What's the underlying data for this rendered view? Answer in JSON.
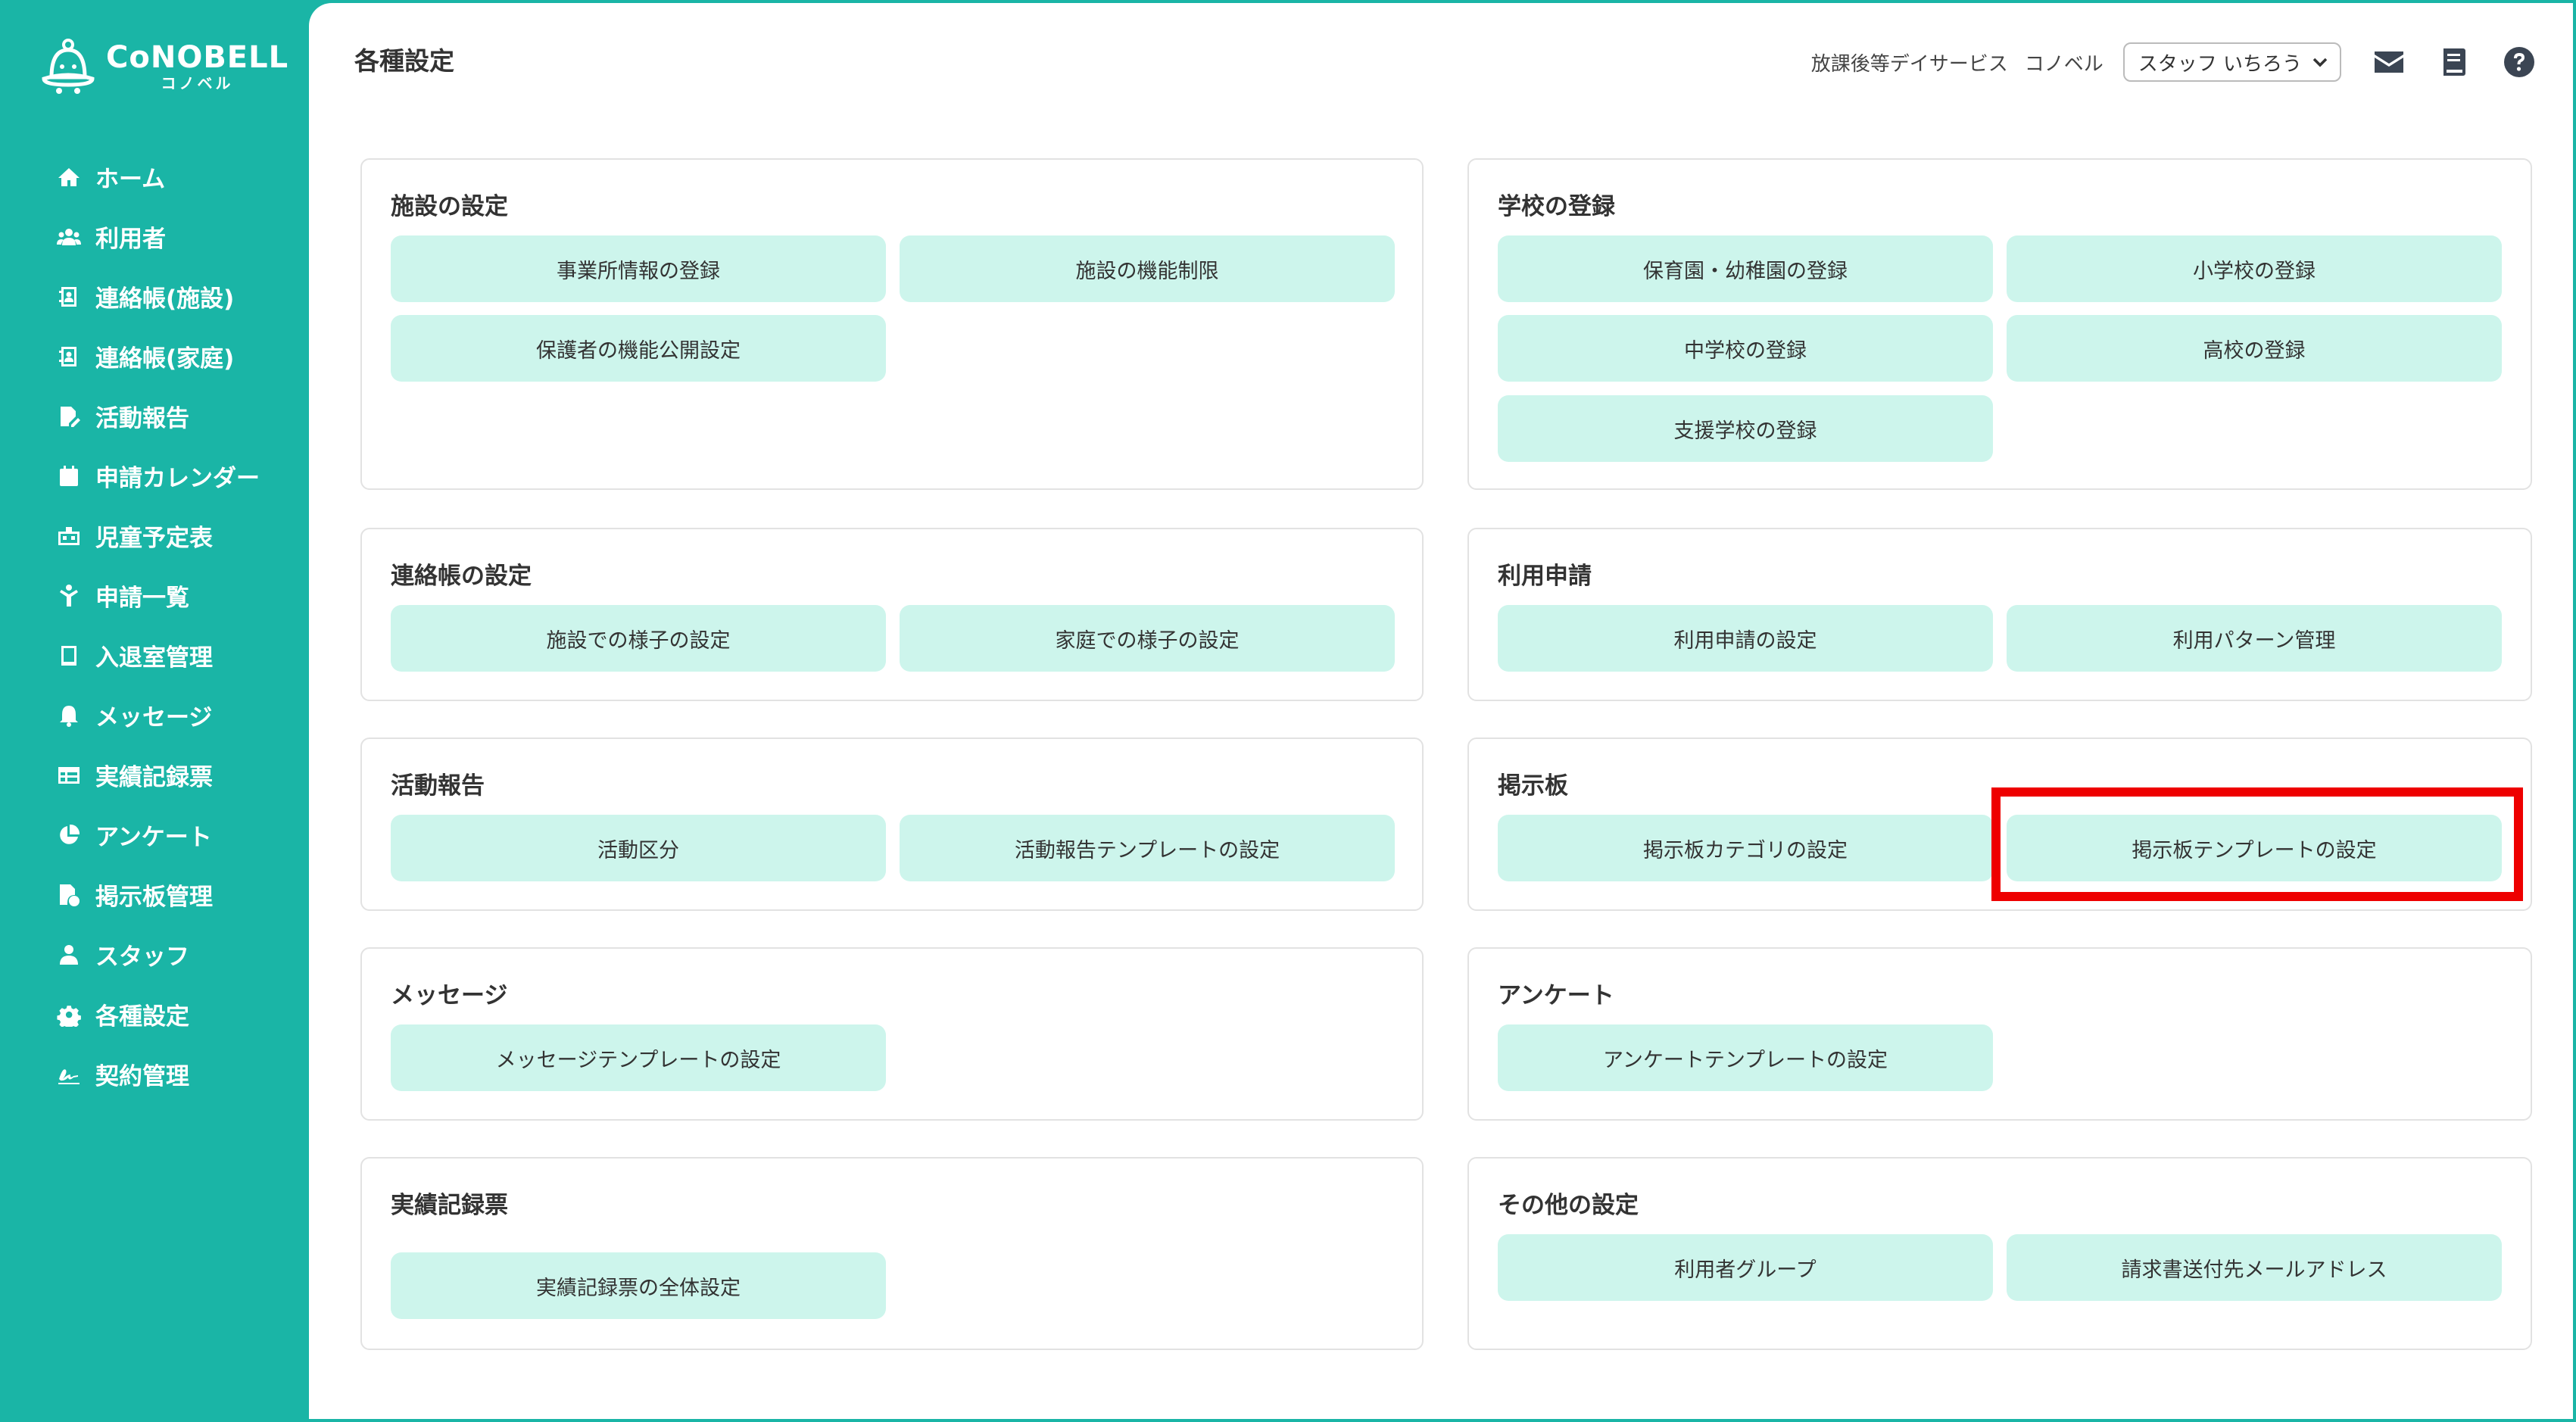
{
  "app": {
    "logo_title": "CoNOBELL",
    "logo_sub": "コノベル"
  },
  "sidebar": {
    "items": [
      {
        "label": "ホーム",
        "icon": "home-icon"
      },
      {
        "label": "利用者",
        "icon": "users-icon"
      },
      {
        "label": "連絡帳(施設)",
        "icon": "contact-book-icon"
      },
      {
        "label": "連絡帳(家庭)",
        "icon": "contact-book-icon"
      },
      {
        "label": "活動報告",
        "icon": "report-edit-icon"
      },
      {
        "label": "申請カレンダー",
        "icon": "calendar-icon"
      },
      {
        "label": "児童予定表",
        "icon": "schedule-icon"
      },
      {
        "label": "申請一覧",
        "icon": "person-icon"
      },
      {
        "label": "入退室管理",
        "icon": "tablet-icon"
      },
      {
        "label": "メッセージ",
        "icon": "bell-icon"
      },
      {
        "label": "実績記録票",
        "icon": "table-icon"
      },
      {
        "label": "アンケート",
        "icon": "pie-chart-icon"
      },
      {
        "label": "掲示板管理",
        "icon": "board-icon"
      },
      {
        "label": "スタッフ",
        "icon": "staff-icon"
      },
      {
        "label": "各種設定",
        "icon": "gear-icon"
      },
      {
        "label": "契約管理",
        "icon": "signature-icon"
      }
    ]
  },
  "header": {
    "title": "各種設定",
    "facility": "放課後等デイサービス",
    "company": "コノベル",
    "staff_selected": "スタッフ いちろう",
    "icons": [
      "mail-icon",
      "book-icon",
      "help-icon"
    ]
  },
  "cards": {
    "facility": {
      "title": "施設の設定",
      "buttons": [
        "事業所情報の登録",
        "施設の機能制限",
        "保護者の機能公開設定"
      ]
    },
    "school": {
      "title": "学校の登録",
      "buttons": [
        "保育園・幼稚園の登録",
        "小学校の登録",
        "中学校の登録",
        "高校の登録",
        "支援学校の登録"
      ]
    },
    "contact": {
      "title": "連絡帳の設定",
      "buttons": [
        "施設での様子の設定",
        "家庭での様子の設定"
      ]
    },
    "usage": {
      "title": "利用申請",
      "buttons": [
        "利用申請の設定",
        "利用パターン管理"
      ]
    },
    "activity": {
      "title": "活動報告",
      "buttons": [
        "活動区分",
        "活動報告テンプレートの設定"
      ]
    },
    "board": {
      "title": "掲示板",
      "buttons": [
        "掲示板カテゴリの設定",
        "掲示板テンプレートの設定"
      ]
    },
    "message": {
      "title": "メッセージ",
      "buttons": [
        "メッセージテンプレートの設定"
      ]
    },
    "survey": {
      "title": "アンケート",
      "buttons": [
        "アンケートテンプレートの設定"
      ]
    },
    "record": {
      "title": "実績記録票",
      "buttons": [
        "実績記録票の全体設定"
      ]
    },
    "other": {
      "title": "その他の設定",
      "buttons": [
        "利用者グループ",
        "請求書送付先メールアドレス"
      ]
    }
  },
  "colors": {
    "sidebar": "#1ab5a6",
    "button": "#cdf5ec",
    "highlight": "#ee0000"
  }
}
